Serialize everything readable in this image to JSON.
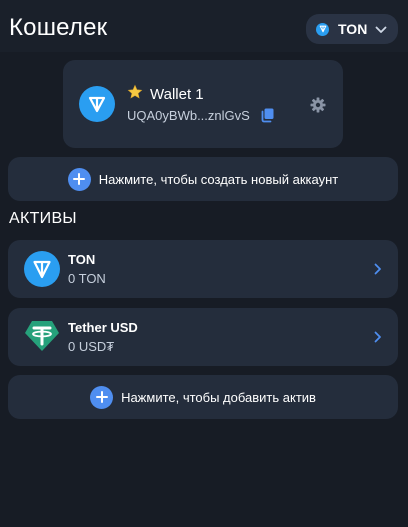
{
  "header": {
    "title": "Кошелек",
    "network": {
      "label": "TON",
      "icon": "ton-icon"
    }
  },
  "wallet": {
    "name": "Wallet 1",
    "address": "UQA0yBWb...znlGvS",
    "favorite_icon": "star-icon",
    "copy_icon": "copy-icon",
    "settings_icon": "gear-icon"
  },
  "create_account": {
    "label": "Нажмите, чтобы создать новый аккаунт"
  },
  "assets": {
    "title": "АКТИВЫ",
    "items": [
      {
        "name": "TON",
        "balance": "0 TON",
        "icon": "ton-icon"
      },
      {
        "name": "Tether USD",
        "balance": "0 USD₮",
        "icon": "tether-icon"
      }
    ]
  },
  "add_asset": {
    "label": "Нажмите, чтобы добавить актив"
  },
  "colors": {
    "background": "#171c25",
    "card": "#242d3c",
    "ton_blue": "#2a9ef1",
    "accent": "#4f8ef0",
    "tether_green": "#26a17b",
    "star": "#f5c842"
  }
}
